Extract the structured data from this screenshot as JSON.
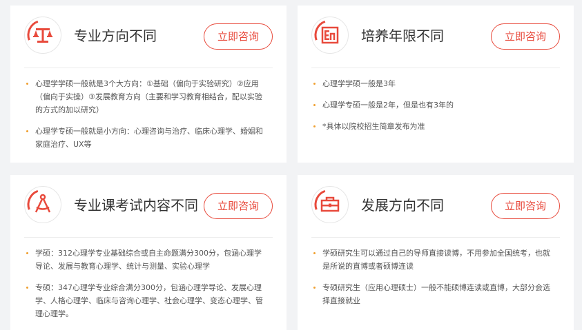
{
  "cards": [
    {
      "title": "专业方向不同",
      "button": "立即咨询",
      "icon": "scale-icon",
      "items": [
        "心理学学硕一般就是3个大方向：①基础（偏向于实验研究）②应用（偏向于实操）③发展教育方向（主要和学习教育相结合，配以实验的方式的加以研究）",
        "心理学专硕一般就是小方向：心理咨询与治疗、临床心理学、婚姻和家庭治疗、UX等"
      ]
    },
    {
      "title": "培养年限不同",
      "button": "立即咨询",
      "icon": "calendar-icon",
      "items": [
        "心理学学硕一般是3年",
        "心理学专硕一般是2年，但是也有3年的",
        "*具体以院校招生简章发布为准"
      ]
    },
    {
      "title": "专业课考试内容不同",
      "button": "立即咨询",
      "icon": "compass-icon",
      "items": [
        "学硕：312心理学专业基础综合或自主命题满分300分，包涵心理学导论、发展与教育心理学、统计与测量、实验心理学",
        "专硕：347心理学专业综合满分300分，包涵心理学导论、发展心理学、人格心理学、临床与咨询心理学、社会心理学、变态心理学、管理心理学。"
      ]
    },
    {
      "title": "发展方向不同",
      "button": "立即咨询",
      "icon": "briefcase-icon",
      "items": [
        "学硕研究生可以通过自己的导师直接读博，不用参加全国统考，也就是所说的直博或者硕博连读",
        "专硕研究生（应用心理硕士）一般不能硕博连读或直博，大部分会选择直接就业"
      ]
    }
  ],
  "colors": {
    "accent": "#e84a3c",
    "bullet": "#f0a030"
  }
}
